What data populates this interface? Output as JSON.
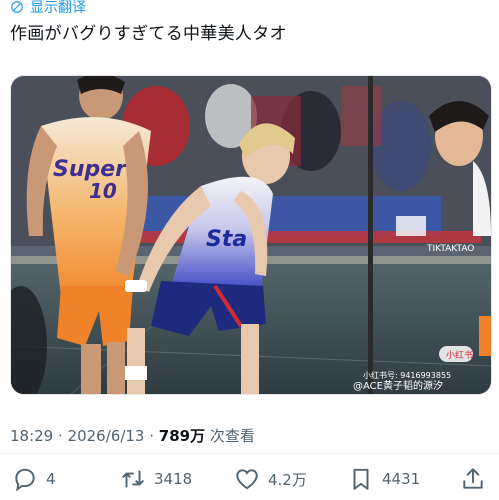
{
  "translate": {
    "label": "显示翻译",
    "icon": "globe-icon"
  },
  "tweet": {
    "text": "作画がバグりすぎてる中華美人タオ"
  },
  "media": {
    "jersey_left_text": "Super",
    "jersey_left_number": "10",
    "jersey_center_text": "Sta",
    "watermark_top": "TIKTAKTAO",
    "watermark_badge": "小红书",
    "watermark_id": "小红书号: 9416993855",
    "watermark_handle": "@ACE黄子韬的源汐"
  },
  "meta": {
    "time": "18:29",
    "separator1": " · ",
    "date": "2026/6/13",
    "separator2": " · ",
    "views_count": "789万",
    "views_label": " 次查看"
  },
  "actions": {
    "reply_count": "4",
    "retweet_count": "3418",
    "like_count": "4.2万",
    "bookmark_count": "4431"
  },
  "colors": {
    "accent": "#1d9bf0",
    "text": "#0f1419",
    "muted": "#536471"
  }
}
